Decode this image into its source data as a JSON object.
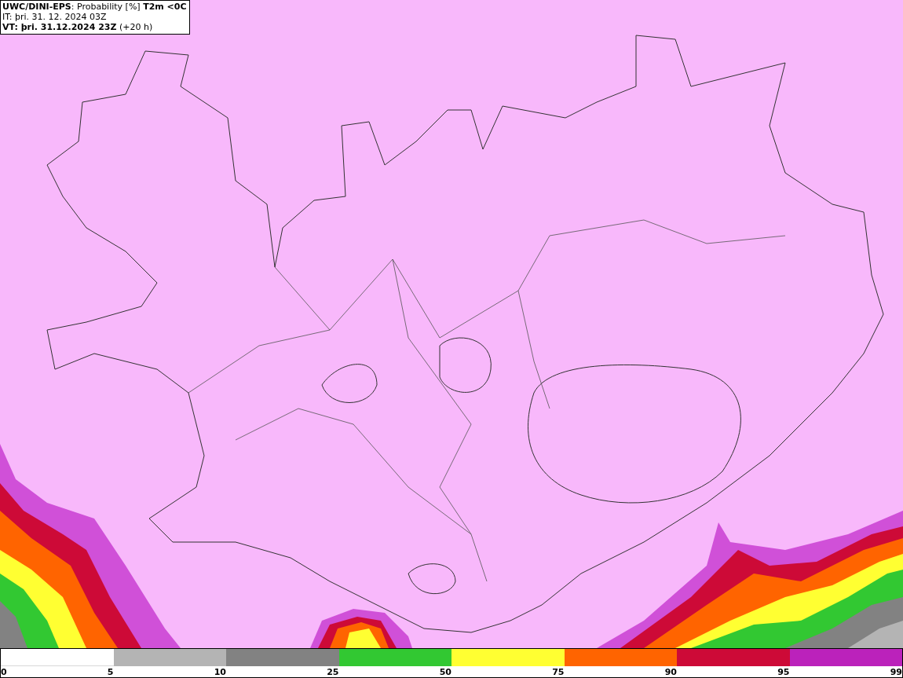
{
  "header": {
    "lines": [
      "**UWC/DINI-EPS**: Probability [%] **T2m <0C**",
      "IT: þri. 31. 12. 2024 03Z",
      "**VT: þri. 31.12.2024 23Z** (+20 h)"
    ]
  },
  "legend": {
    "start_label": "0",
    "segments": [
      {
        "color": "#ffffff",
        "label": "5"
      },
      {
        "color": "#b4b4b4",
        "label": "10"
      },
      {
        "color": "#828282",
        "label": "25"
      },
      {
        "color": "#32c832",
        "label": "50"
      },
      {
        "color": "#ffff32",
        "label": "75"
      },
      {
        "color": "#ff6400",
        "label": "90"
      },
      {
        "color": "#cd0a37",
        "label": "95"
      },
      {
        "color": "#bb22bb",
        "label": "99"
      }
    ]
  }
}
